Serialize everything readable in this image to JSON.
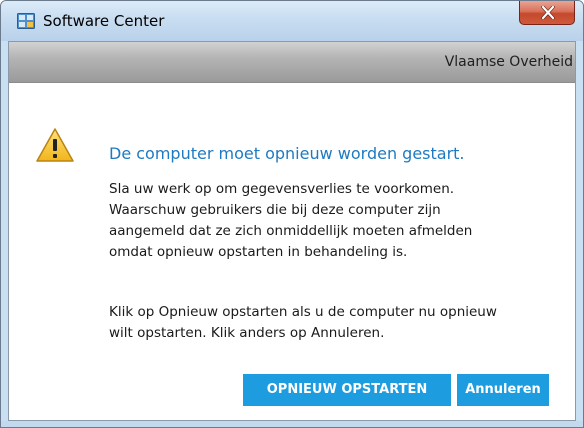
{
  "window": {
    "title": "Software Center",
    "app_icon": "software-center-icon",
    "close_icon": "close-icon",
    "close_button_color": "#c4482d"
  },
  "banner": {
    "organization": "Vlaamse Overheid"
  },
  "message": {
    "icon": "warning-icon",
    "heading": "De computer moet opnieuw worden gestart.",
    "heading_color": "#1e7ac2",
    "paragraph1": [
      "Sla uw werk op om gegevensverlies te voorkomen.",
      "Waarschuw gebruikers die bij deze computer zijn",
      "aangemeld dat ze zich onmiddellijk moeten afmelden",
      "omdat opnieuw opstarten in behandeling is."
    ],
    "paragraph2": [
      "Klik op Opnieuw opstarten als u de computer nu opnieuw",
      "wilt opstarten. Klik anders op Annuleren."
    ]
  },
  "buttons": {
    "restart_label": "OPNIEUW OPSTARTEN",
    "cancel_label": "Annuleren",
    "button_color": "#1e9ce0"
  }
}
